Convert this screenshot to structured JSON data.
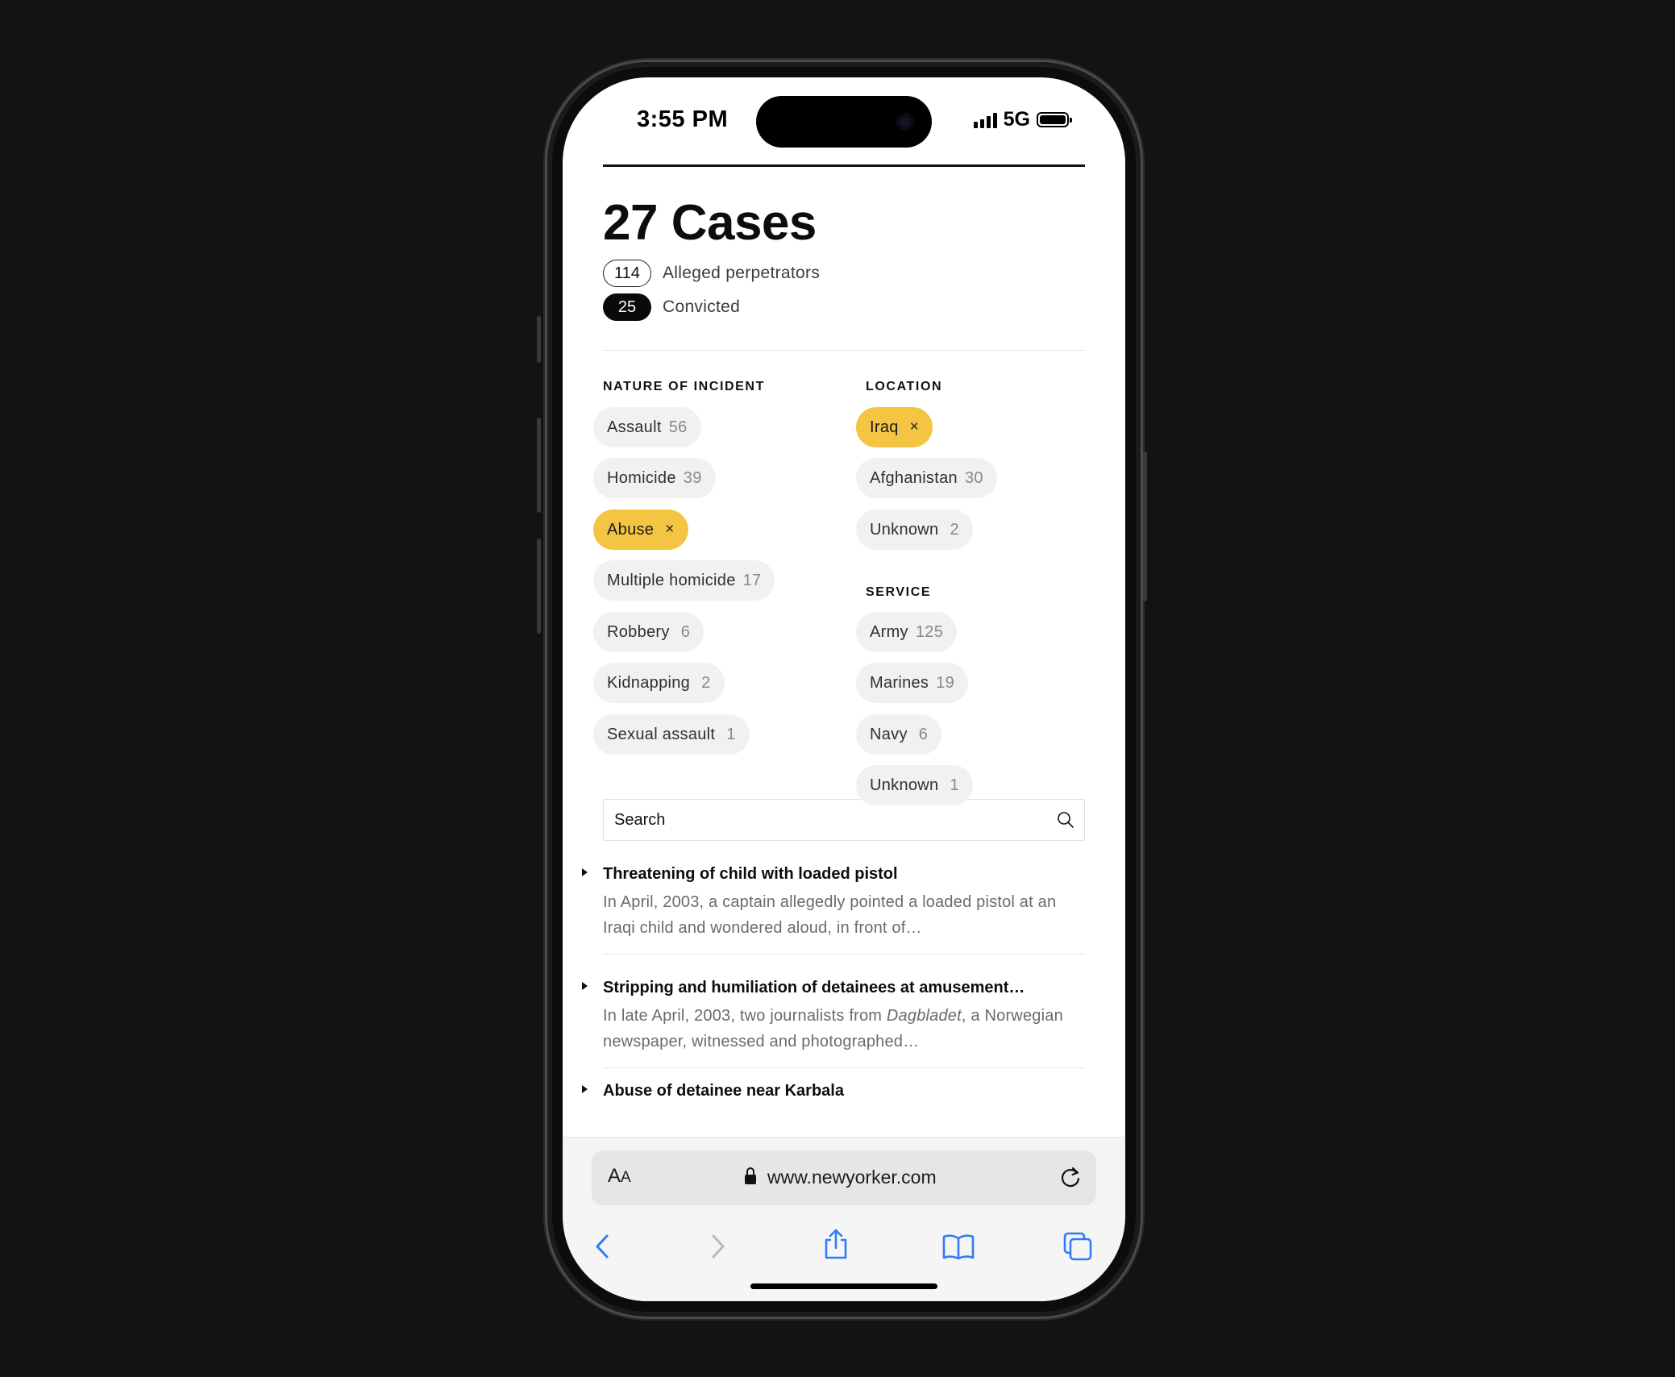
{
  "status_bar": {
    "time": "3:55 PM",
    "network": "5G"
  },
  "header": {
    "title": "27 Cases",
    "stats": [
      {
        "value": "114",
        "label": "Alleged perpetrators"
      },
      {
        "value": "25",
        "label": "Convicted"
      }
    ]
  },
  "filters": {
    "nature": {
      "heading": "NATURE OF INCIDENT",
      "chips": [
        {
          "label": "Assault",
          "count": "56"
        },
        {
          "label": "Homicide",
          "count": "39"
        },
        {
          "label": "Abuse",
          "count": "",
          "active": true
        },
        {
          "label": "Multiple homicide",
          "count": "17"
        },
        {
          "label": "Robbery",
          "count": "6"
        },
        {
          "label": "Kidnapping",
          "count": "2"
        },
        {
          "label": "Sexual assault",
          "count": "1"
        }
      ]
    },
    "location": {
      "heading": "LOCATION",
      "chips": [
        {
          "label": "Iraq",
          "count": "",
          "active": true
        },
        {
          "label": "Afghanistan",
          "count": "30"
        },
        {
          "label": "Unknown",
          "count": "2"
        }
      ]
    },
    "service": {
      "heading": "SERVICE",
      "chips": [
        {
          "label": "Army",
          "count": "125"
        },
        {
          "label": "Marines",
          "count": "19"
        },
        {
          "label": "Navy",
          "count": "6"
        },
        {
          "label": "Unknown",
          "count": "1"
        }
      ]
    },
    "remove_glyph": "×"
  },
  "search": {
    "placeholder": "Search"
  },
  "cases": [
    {
      "title": "Threatening of child with loaded pistol",
      "desc_before": "In April, 2003, a captain allegedly pointed a loaded pistol at an Iraqi child and wondered aloud, in front of…",
      "desc_italic": "",
      "desc_after": ""
    },
    {
      "title": "Stripping and humiliation of detainees at amusement…",
      "desc_before": "In late April, 2003, two journalists from ",
      "desc_italic": "Dagbladet",
      "desc_after": ", a Norwegian newspaper, witnessed and photographed…"
    },
    {
      "title": "Abuse of detainee near Karbala",
      "desc_before": "",
      "desc_italic": "",
      "desc_after": ""
    }
  ],
  "browser": {
    "text_size_label": "A",
    "text_size_label_small": "A",
    "url": "www.newyorker.com"
  },
  "colors": {
    "active_chip": "#f4c443",
    "link_blue": "#2f7cf6",
    "chip_bg": "#f1f1f1"
  }
}
